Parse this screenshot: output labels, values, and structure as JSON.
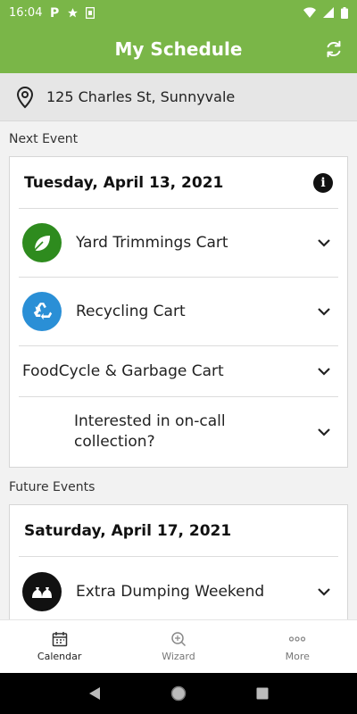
{
  "status_bar": {
    "time": "16:04",
    "icons": [
      "parking-notification-icon",
      "star-notification-icon",
      "sim-notification-icon",
      "wifi-icon",
      "signal-icon",
      "battery-icon"
    ]
  },
  "app_bar": {
    "title": "My Schedule",
    "refresh_icon": "refresh-icon",
    "bg_color": "#7ab648"
  },
  "address": {
    "icon": "location-pin-icon",
    "text": "125 Charles St, Sunnyvale"
  },
  "next_event": {
    "section_label": "Next Event",
    "date": "Tuesday, April 13, 2021",
    "info_icon": "info-icon",
    "items": [
      {
        "label": "Yard Trimmings Cart",
        "icon": "leaf-icon",
        "icon_color": "#2e8b1e"
      },
      {
        "label": "Recycling Cart",
        "icon": "recycle-icon",
        "icon_color": "#2a8fd6"
      },
      {
        "label": "FoodCycle & Garbage Cart"
      },
      {
        "label": "Interested in on-call collection?"
      }
    ]
  },
  "future_events": {
    "section_label": "Future Events",
    "date": "Saturday, April 17, 2021",
    "items": [
      {
        "label": "Extra Dumping Weekend",
        "icon": "dumping-bags-icon",
        "icon_color": "#111111"
      }
    ]
  },
  "bottom_nav": {
    "items": [
      {
        "label": "Calendar",
        "icon": "calendar-icon",
        "active": true
      },
      {
        "label": "Wizard",
        "icon": "wizard-icon",
        "active": false
      },
      {
        "label": "More",
        "icon": "more-dots-icon",
        "active": false
      }
    ]
  },
  "system_nav": {
    "icons": [
      "back-icon",
      "home-icon",
      "recents-icon"
    ]
  }
}
